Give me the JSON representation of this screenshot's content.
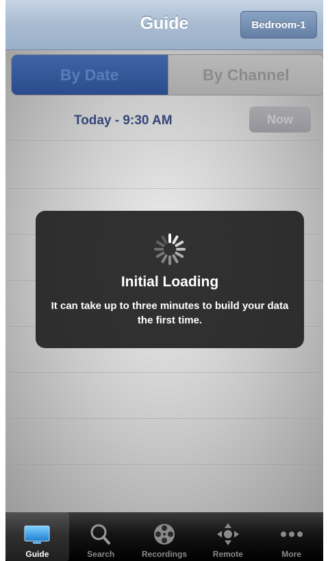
{
  "header": {
    "title": "Guide",
    "room_button": "Bedroom-1"
  },
  "segments": {
    "by_date": "By Date",
    "by_channel": "By Channel",
    "selected": "By Date"
  },
  "date_row": {
    "label": "Today - 9:30 AM",
    "now_button": "Now"
  },
  "loading": {
    "title": "Initial Loading",
    "message": "It can take up to three minutes to build your data the first time."
  },
  "tabs": [
    {
      "label": "Guide",
      "icon": "tv-icon",
      "selected": true
    },
    {
      "label": "Search",
      "icon": "search-icon",
      "selected": false
    },
    {
      "label": "Recordings",
      "icon": "film-reel-icon",
      "selected": false
    },
    {
      "label": "Remote",
      "icon": "dpad-icon",
      "selected": false
    },
    {
      "label": "More",
      "icon": "more-dots-icon",
      "selected": false
    }
  ],
  "colors": {
    "nav_bar": "#a9bbd1",
    "segment_active": "#2a4c8c",
    "date_text": "#34477a",
    "overlay": "#222222",
    "tab_bar": "#141414"
  }
}
